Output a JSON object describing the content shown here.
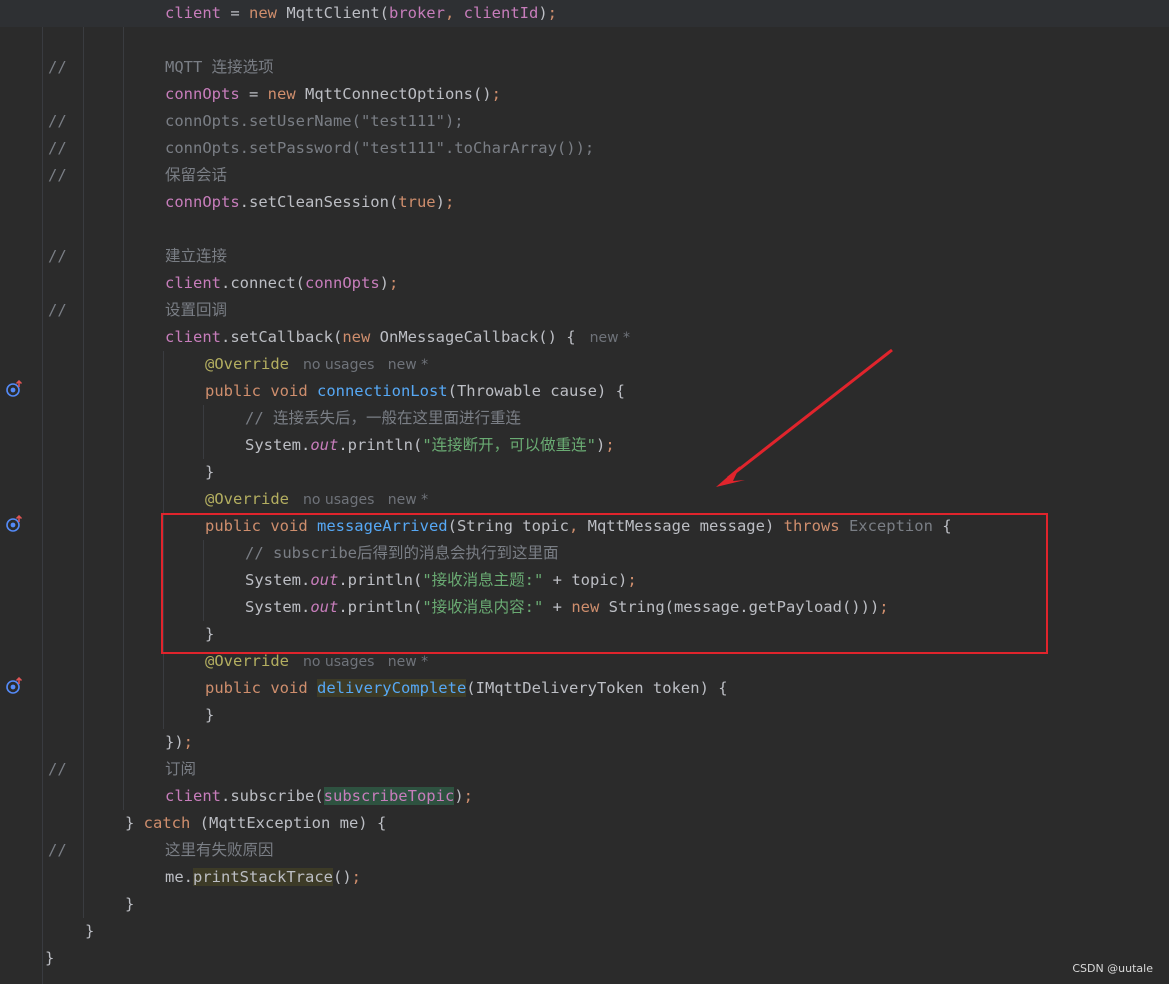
{
  "watermark": "CSDN @uutale",
  "line_comment_marker": "//",
  "inline_hints": {
    "new_star": "new *",
    "no_usages": "no usages"
  },
  "code_lines": [
    {
      "tokens": [
        [
          "field",
          "client"
        ],
        [
          "plain",
          " = "
        ],
        [
          "kw",
          "new "
        ],
        [
          "plain",
          "MqttClient("
        ],
        [
          "field",
          "broker"
        ],
        [
          "kw",
          ", "
        ],
        [
          "field",
          "clientId"
        ],
        [
          "plain",
          ")"
        ],
        [
          "kw",
          ";"
        ]
      ]
    },
    {
      "tokens": []
    },
    {
      "tokens": [
        [
          "cmt",
          "MQTT 连接选项"
        ]
      ],
      "commented": true
    },
    {
      "tokens": [
        [
          "field",
          "connOpts"
        ],
        [
          "plain",
          " = "
        ],
        [
          "kw",
          "new "
        ],
        [
          "plain",
          "MqttConnectOptions()"
        ],
        [
          "kw",
          ";"
        ]
      ]
    },
    {
      "tokens": [
        [
          "cmt",
          "connOpts.setUserName(\"test111\");"
        ]
      ],
      "commented": true
    },
    {
      "tokens": [
        [
          "cmt",
          "connOpts.setPassword(\"test111\".toCharArray());"
        ]
      ],
      "commented": true
    },
    {
      "tokens": [
        [
          "cmt",
          "保留会话"
        ]
      ],
      "commented": true
    },
    {
      "tokens": [
        [
          "field",
          "connOpts"
        ],
        [
          "plain",
          ".setCleanSession("
        ],
        [
          "kw",
          "true"
        ],
        [
          "plain",
          ")"
        ],
        [
          "kw",
          ";"
        ]
      ]
    },
    {
      "tokens": []
    },
    {
      "tokens": [
        [
          "cmt",
          "建立连接"
        ]
      ],
      "commented": true
    },
    {
      "tokens": [
        [
          "field",
          "client"
        ],
        [
          "plain",
          ".connect("
        ],
        [
          "field",
          "connOpts"
        ],
        [
          "plain",
          ")"
        ],
        [
          "kw",
          ";"
        ]
      ]
    },
    {
      "tokens": [
        [
          "cmt",
          "设置回调"
        ]
      ],
      "commented": true
    },
    {
      "tokens": [
        [
          "field",
          "client"
        ],
        [
          "plain",
          ".setCallback("
        ],
        [
          "kw",
          "new "
        ],
        [
          "plain",
          "OnMessageCallback() {"
        ]
      ],
      "hint": "new *"
    },
    {
      "tokens": [
        [
          "ann",
          "@Override"
        ]
      ],
      "hint": "no usages   new *"
    },
    {
      "tokens": [
        [
          "kw",
          "public void "
        ],
        [
          "fn-decl",
          "connectionLost"
        ],
        [
          "plain",
          "(Throwable cause) {"
        ]
      ]
    },
    {
      "tokens": [
        [
          "cmt",
          "// 连接丢失后，一般在这里面进行重连"
        ]
      ]
    },
    {
      "tokens": [
        [
          "plain",
          "System."
        ],
        [
          "field it",
          "out"
        ],
        [
          "plain",
          ".println("
        ],
        [
          "str",
          "\"连接断开，可以做重连\""
        ],
        [
          "plain",
          ")"
        ],
        [
          "kw",
          ";"
        ]
      ]
    },
    {
      "tokens": [
        [
          "plain",
          "}"
        ]
      ]
    },
    {
      "tokens": [
        [
          "ann",
          "@Override"
        ]
      ],
      "hint": "no usages   new *"
    },
    {
      "tokens": [
        [
          "kw",
          "public void "
        ],
        [
          "fn-decl",
          "messageArrived"
        ],
        [
          "plain",
          "(String topic"
        ],
        [
          "kw",
          ", "
        ],
        [
          "plain",
          "MqttMessage message) "
        ],
        [
          "kw",
          "throws "
        ],
        [
          "cmt",
          "Exception"
        ],
        [
          "plain",
          " {"
        ]
      ]
    },
    {
      "tokens": [
        [
          "cmt",
          "// subscribe后得到的消息会执行到这里面"
        ]
      ]
    },
    {
      "tokens": [
        [
          "plain",
          "System."
        ],
        [
          "field it",
          "out"
        ],
        [
          "plain",
          ".println("
        ],
        [
          "str",
          "\"接收消息主题:\""
        ],
        [
          "plain",
          " + topic)"
        ],
        [
          "kw",
          ";"
        ]
      ]
    },
    {
      "tokens": [
        [
          "plain",
          "System."
        ],
        [
          "field it",
          "out"
        ],
        [
          "plain",
          ".println("
        ],
        [
          "str",
          "\"接收消息内容:\""
        ],
        [
          "plain",
          " + "
        ],
        [
          "kw",
          "new "
        ],
        [
          "plain",
          "String(message.getPayload()))"
        ],
        [
          "kw",
          ";"
        ]
      ]
    },
    {
      "tokens": [
        [
          "plain",
          "}"
        ]
      ]
    },
    {
      "tokens": [
        [
          "ann",
          "@Override"
        ]
      ],
      "hint": "no usages   new *"
    },
    {
      "tokens": [
        [
          "kw",
          "public void "
        ],
        [
          "fn-decl hl-warn",
          "deliveryComplete"
        ],
        [
          "plain",
          "(IMqttDeliveryToken token) {"
        ]
      ]
    },
    {
      "tokens": [
        [
          "plain",
          "}"
        ]
      ]
    },
    {
      "tokens": [
        [
          "plain",
          "})"
        ],
        [
          "kw",
          ";"
        ]
      ]
    },
    {
      "tokens": [
        [
          "cmt",
          "订阅"
        ]
      ],
      "commented": true
    },
    {
      "tokens": [
        [
          "field",
          "client"
        ],
        [
          "plain",
          ".subscribe("
        ],
        [
          "field hl-green",
          "subscribeTopic"
        ],
        [
          "plain",
          ")"
        ],
        [
          "kw",
          ";"
        ]
      ]
    },
    {
      "tokens": [
        [
          "plain",
          "} "
        ],
        [
          "kw",
          "catch "
        ],
        [
          "plain",
          "(MqttException me) {"
        ]
      ]
    },
    {
      "tokens": [
        [
          "cmt",
          "这里有失败原因"
        ]
      ],
      "commented": true
    },
    {
      "tokens": [
        [
          "plain",
          "me."
        ],
        [
          "plain hl-warn",
          "printStackTrace"
        ],
        [
          "plain",
          "()"
        ],
        [
          "kw",
          ";"
        ]
      ]
    },
    {
      "tokens": [
        [
          "plain",
          "}"
        ]
      ]
    },
    {
      "tokens": [
        [
          "plain",
          "}"
        ]
      ]
    },
    {
      "tokens": [
        [
          "plain",
          "}"
        ]
      ]
    }
  ],
  "gutter_icons": [
    "override-method-icon",
    "override-method-icon",
    "override-method-icon"
  ],
  "annotations": {
    "highlight_box": "red-rectangle",
    "pointer": "red-arrow"
  }
}
